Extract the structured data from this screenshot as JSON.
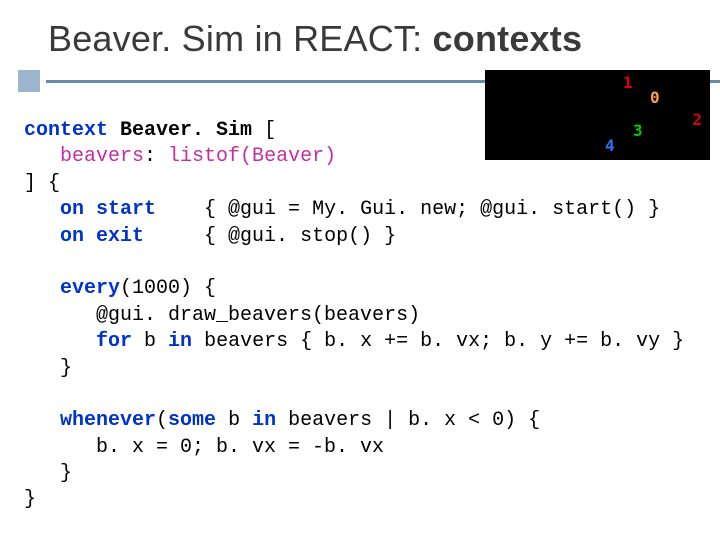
{
  "title": {
    "pre": "Beaver. Sim in REACT: ",
    "bold": "contexts"
  },
  "thumb": {
    "n1": "1",
    "n0": "0",
    "n2": "2",
    "n3": "3",
    "n4": "4"
  },
  "code": {
    "kw_context": "context",
    "ctx_name": "Beaver. Sim",
    "open_br": " [",
    "field_ind": "   ",
    "field_name": "beavers",
    "field_sep": ": ",
    "field_type": "listof(Beaver)",
    "close_br": "] {",
    "on_start_ind": "   ",
    "kw_on_start": "on start",
    "on_start_gap": "    ",
    "on_start_body": "{ @gui = My. Gui. new; @gui. start() }",
    "on_exit_ind": "   ",
    "kw_on_exit": "on exit",
    "on_exit_gap": "     ",
    "on_exit_body": "{ @gui. stop() }",
    "blank1": "",
    "every_ind": "   ",
    "kw_every": "every",
    "every_arg": "(1000) {",
    "every_l1_ind": "      ",
    "every_l1": "@gui. draw_beavers(beavers)",
    "every_l2_ind": "      ",
    "kw_for": "for",
    "every_l2_mid1": " b ",
    "kw_in": "in",
    "every_l2_mid2": " beavers { b. x += b. vx; b. y += b. vy }",
    "every_close_ind": "   ",
    "every_close": "}",
    "blank2": "",
    "when_ind": "   ",
    "kw_whenever": "whenever",
    "when_open": "(",
    "kw_some": "some",
    "when_mid1": " b ",
    "kw_in2": "in",
    "when_mid2": " beavers | b. x < 0) {",
    "when_body_ind": "      ",
    "when_body": "b. x = 0; b. vx = -b. vx",
    "when_close_ind": "   ",
    "when_close": "}",
    "ctx_close": "}"
  }
}
